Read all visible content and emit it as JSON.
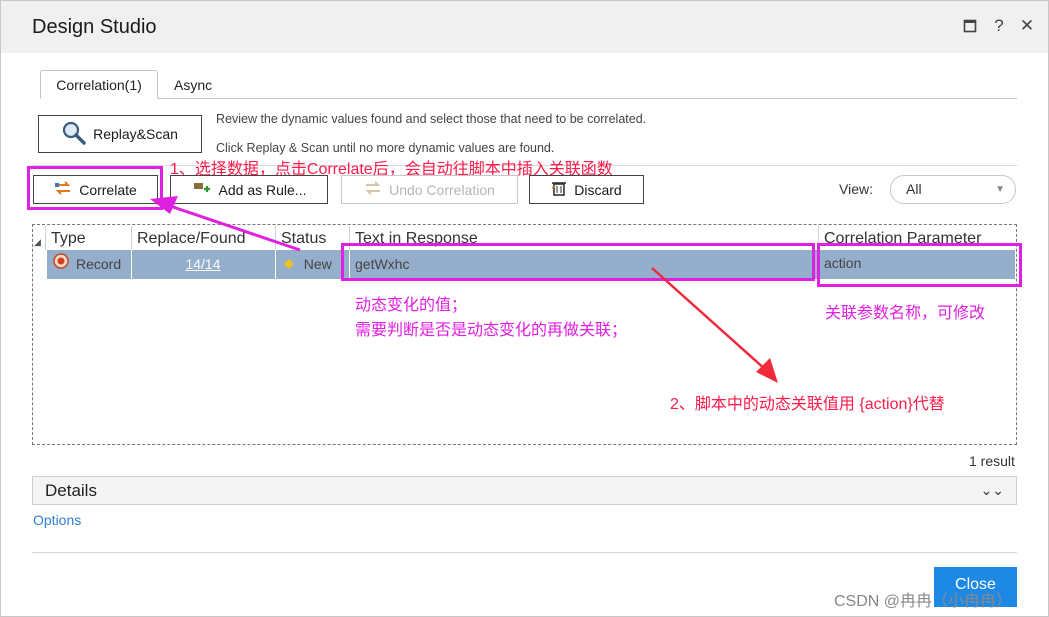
{
  "window": {
    "title": "Design Studio",
    "maximize_icon": "maximize-icon",
    "help": "?",
    "close": "✕"
  },
  "tabs": [
    {
      "label": "Correlation(1)",
      "active": true
    },
    {
      "label": "Async",
      "active": false
    }
  ],
  "toolbar": {
    "replay_scan": "Replay&Scan",
    "info_line1": "Review the dynamic values found and select those that need to be correlated.",
    "info_line2": "Click Replay & Scan until no more dynamic values are found.",
    "correlate": "Correlate",
    "add_as_rule": "Add as Rule...",
    "undo_correlation": "Undo Correlation",
    "discard": "Discard",
    "view_label": "View:",
    "view_value": "All"
  },
  "table": {
    "headers": [
      "Type",
      "Replace/Found",
      "Status",
      "Text in Response",
      "Correlation Parameter"
    ],
    "rows": [
      {
        "type": "Record",
        "replace_found": "14/14",
        "status": "New",
        "text": "getWxhc",
        "parameter": "action"
      }
    ],
    "result_count": "1 result"
  },
  "details": {
    "label": "Details"
  },
  "options": {
    "label": "Options"
  },
  "close_button": "Close",
  "annotations": {
    "step1": "1、选择数据，点击Correlate后，会自动往脚本中插入关联函数",
    "dynamic_line1": "动态变化的值；",
    "dynamic_line2": "需要判断是否是动态变化的再做关联；",
    "param_note": "关联参数名称，可修改",
    "step2": "2、脚本中的动态关联值用 {action}代替"
  },
  "watermark": "CSDN @冉冉（小冉冉）",
  "colors": {
    "annotation_red": "#ff1a4a",
    "annotation_magenta": "#e020e0",
    "row_selected": "#94aecc",
    "close_blue": "#1e88e5"
  }
}
